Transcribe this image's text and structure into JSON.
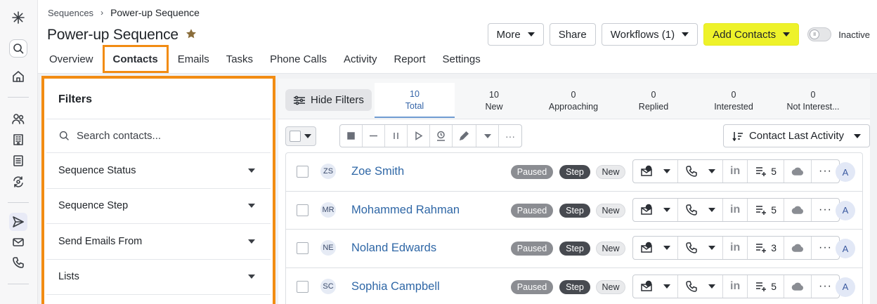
{
  "breadcrumb": {
    "parent": "Sequences",
    "separator": "›",
    "current": "Power-up Sequence"
  },
  "page": {
    "title": "Power-up Sequence"
  },
  "tabs": [
    {
      "label": "Overview"
    },
    {
      "label": "Contacts",
      "active": true
    },
    {
      "label": "Emails"
    },
    {
      "label": "Tasks"
    },
    {
      "label": "Phone Calls"
    },
    {
      "label": "Activity"
    },
    {
      "label": "Report"
    },
    {
      "label": "Settings"
    }
  ],
  "actions": {
    "more_label": "More",
    "share_label": "Share",
    "workflows_label": "Workflows (1)",
    "add_contacts_label": "Add Contacts",
    "toggle_label": "Inactive",
    "toggle_knob": "II"
  },
  "filters": {
    "title": "Filters",
    "search_placeholder": "Search contacts...",
    "items": [
      {
        "label": "Sequence Status"
      },
      {
        "label": "Sequence Step"
      },
      {
        "label": "Send Emails From"
      },
      {
        "label": "Lists"
      }
    ]
  },
  "stats": {
    "hide_filters_label": "Hide Filters",
    "items": [
      {
        "count": "10",
        "label": "Total",
        "active": true
      },
      {
        "count": "10",
        "label": "New"
      },
      {
        "count": "0",
        "label": "Approaching"
      },
      {
        "count": "0",
        "label": "Replied"
      },
      {
        "count": "0",
        "label": "Interested"
      },
      {
        "count": "0",
        "label": "Not Interest..."
      }
    ]
  },
  "toolbar": {
    "sort_label": "Contact Last Activity",
    "more_glyph": "···"
  },
  "contacts": [
    {
      "initials": "ZS",
      "name": "Zoe Smith",
      "status": "Paused",
      "step": "Step",
      "stage": "New",
      "task_count": "5",
      "linkedin": "in",
      "owner": "A"
    },
    {
      "initials": "MR",
      "name": "Mohammed Rahman",
      "status": "Paused",
      "step": "Step",
      "stage": "New",
      "task_count": "5",
      "linkedin": "in",
      "owner": "A"
    },
    {
      "initials": "NE",
      "name": "Noland Edwards",
      "status": "Paused",
      "step": "Step",
      "stage": "New",
      "task_count": "3",
      "linkedin": "in",
      "owner": "A"
    },
    {
      "initials": "SC",
      "name": "Sophia Campbell",
      "status": "Paused",
      "step": "Step",
      "stage": "New",
      "task_count": "5",
      "linkedin": "in",
      "owner": "A"
    }
  ],
  "colors": {
    "accent_highlight": "#f28c13",
    "primary_button": "#eef22a",
    "link": "#2f67a6",
    "paused_badge": "#8b8d92",
    "step_badge": "#474a50"
  },
  "icons": {
    "rail": [
      "logo-icon",
      "search-icon",
      "home-icon",
      "people-icon",
      "building-icon",
      "list-icon",
      "sync-icon",
      "send-icon",
      "mail-icon",
      "phone-icon"
    ]
  }
}
